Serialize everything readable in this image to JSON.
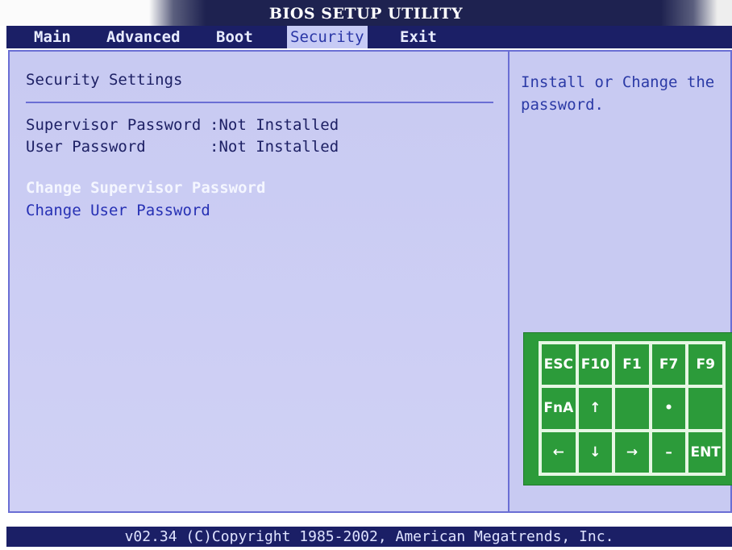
{
  "window": {
    "title": "BIOS SETUP UTILITY"
  },
  "menu": {
    "tabs": [
      {
        "label": "Main"
      },
      {
        "label": "Advanced"
      },
      {
        "label": "Boot"
      },
      {
        "label": "Security",
        "active": true
      },
      {
        "label": "Exit"
      }
    ]
  },
  "settings": {
    "section_title": "Security Settings",
    "status_rows": [
      {
        "label": "Supervisor Password",
        "value": ":Not Installed"
      },
      {
        "label": "User Password",
        "value": ":Not Installed"
      }
    ],
    "options": [
      {
        "label": "Change Supervisor Password",
        "selected": true
      },
      {
        "label": "Change User Password",
        "selected": false
      }
    ]
  },
  "help": {
    "text": "Install or Change the password."
  },
  "keypad": {
    "keys": [
      "ESC",
      "F10",
      "F1",
      "F7",
      "F9",
      "FnA",
      "↑",
      "",
      "•",
      "",
      "←",
      "↓",
      "→",
      "–",
      "ENT"
    ]
  },
  "footer": {
    "text": "v02.34 (C)Copyright 1985-2002, American Megatrends, Inc."
  },
  "colors": {
    "menu_bar": "#1b1f66",
    "panel_bg": "#cbcdf3",
    "selected_option": "#f4f6ff",
    "option_text": "#2630b4",
    "keypad_bg": "#2c9b3a"
  }
}
